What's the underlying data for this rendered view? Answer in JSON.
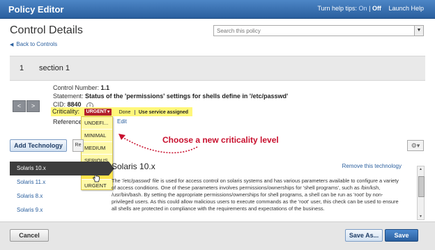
{
  "header": {
    "title": "Policy Editor",
    "help_tips_label": "Turn help tips:",
    "help_on": "On",
    "help_separator": "|",
    "help_off": "Off",
    "launch_help": "Launch Help"
  },
  "page": {
    "title": "Control Details",
    "search_placeholder": "Search this policy",
    "back_link": "Back to Controls"
  },
  "section": {
    "number": "1",
    "name": "section 1"
  },
  "control": {
    "number_label": "Control Number:",
    "number_value": "1.1",
    "statement_label": "Statement:",
    "statement_value": "Status of the 'permissions' settings for shells define in '/etc/passwd'",
    "cid_label": "CID:",
    "cid_value": "8840",
    "criticality_label": "Criticality:",
    "criticality_value": "URGENT",
    "done_label": "Done",
    "use_assigned_label": "Use service assigned",
    "reference_label": "Reference",
    "edit_label": "Edit"
  },
  "criticality_menu": {
    "options": [
      "UNDEFI...",
      "MINIMAL",
      "MEDIUM",
      "SERIOUS",
      "CRITICAL",
      "URGENT"
    ],
    "hovered": "CRITICAL"
  },
  "annotation": {
    "text": "Choose a new criticality level",
    "color": "#c8102e"
  },
  "toolbar": {
    "add_technology": "Add Technology",
    "re_button": "Re"
  },
  "technologies": {
    "items": [
      "Solaris 10.x",
      "Solaris 11.x",
      "Solaris 8.x",
      "Solaris 9.x"
    ],
    "selected": "Solaris 10.x"
  },
  "detail": {
    "title": "Solaris 10.x",
    "remove_link": "Remove this technology",
    "text": "The '/etc/passwd' file is used for access control on solaris systems and has various parameters available to configure a variety of access conditions. One of these parameters involves permissions/ownerships for 'shell programs', such as /bin/ksh, /usr/bin/bash. By setting the appropriate permissions/ownerships for shell programs, a shell can be run as 'root' by non-privileged users. As this could allow malicious users to execute commands as the 'root' user, this check can be used to ensure all shells are protected in compliance with the requirements and expectations of the business."
  },
  "footer": {
    "cancel": "Cancel",
    "save_as": "Save As...",
    "save": "Save"
  },
  "colors": {
    "header_blue": "#2a5f9e",
    "urgent_red": "#b3202a",
    "highlight_yellow": "#fff77a"
  }
}
